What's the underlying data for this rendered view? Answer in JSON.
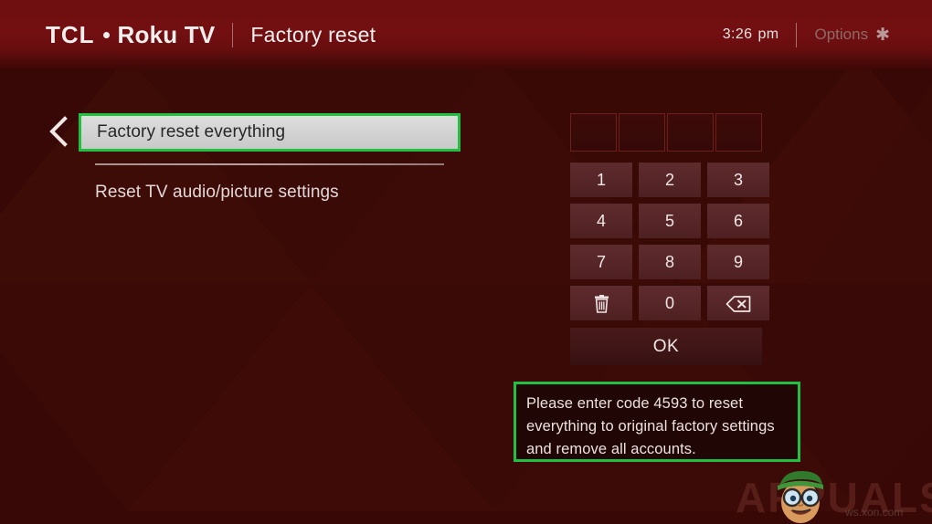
{
  "header": {
    "brand_tcl": "TCL",
    "brand_dot": "bullet-dot",
    "brand_roku": "Roku TV",
    "separator": "|",
    "page_title": "Factory reset",
    "clock_time": "3:26",
    "clock_ampm": "pm",
    "options_label": "Options",
    "options_icon": "asterisk-icon"
  },
  "back": {
    "icon": "chevron-left-icon"
  },
  "menu": {
    "items": [
      {
        "label": "Factory reset everything",
        "selected": true,
        "highlighted": true
      },
      {
        "label": "Reset TV audio/picture settings",
        "selected": false,
        "highlighted": false
      }
    ]
  },
  "keypad": {
    "code_boxes": [
      "",
      "",
      "",
      ""
    ],
    "keys": [
      {
        "label": "1",
        "name": "key-1",
        "icon": null
      },
      {
        "label": "2",
        "name": "key-2",
        "icon": null
      },
      {
        "label": "3",
        "name": "key-3",
        "icon": null
      },
      {
        "label": "4",
        "name": "key-4",
        "icon": null
      },
      {
        "label": "5",
        "name": "key-5",
        "icon": null
      },
      {
        "label": "6",
        "name": "key-6",
        "icon": null
      },
      {
        "label": "7",
        "name": "key-7",
        "icon": null
      },
      {
        "label": "8",
        "name": "key-8",
        "icon": null
      },
      {
        "label": "9",
        "name": "key-9",
        "icon": null
      },
      {
        "label": "",
        "name": "key-clear",
        "icon": "trash-icon"
      },
      {
        "label": "0",
        "name": "key-0",
        "icon": null
      },
      {
        "label": "",
        "name": "key-backspace",
        "icon": "backspace-icon"
      }
    ],
    "ok_label": "OK"
  },
  "message": {
    "text": "Please enter code 4593 to reset everything to original factory settings and remove all accounts.",
    "code": "4593"
  },
  "watermark": {
    "text": "APPUALS",
    "subtext": "ws.xon.com"
  },
  "colors": {
    "accent_green": "#21c03e",
    "header_red": "#730f11",
    "background_red": "#380806",
    "key_face": "#562527",
    "selected_bg": "#d2d2d2",
    "selected_text": "#272727"
  }
}
